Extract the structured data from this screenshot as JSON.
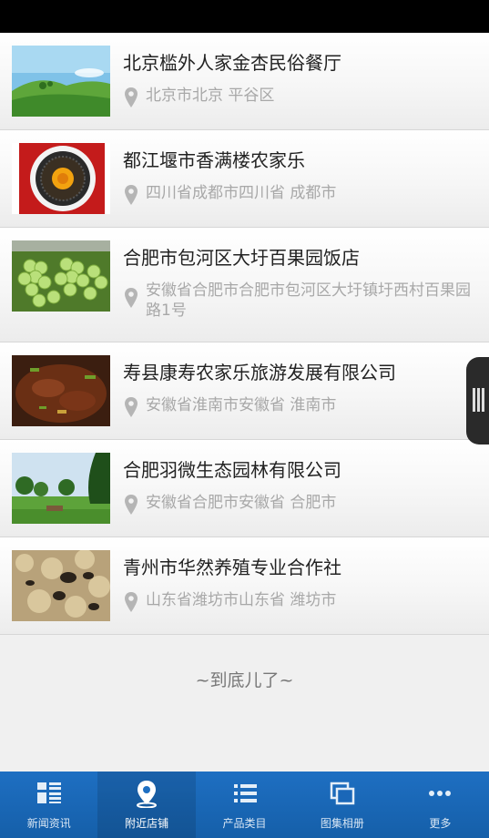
{
  "listings": [
    {
      "name": "北京槛外人家金杏民俗餐厅",
      "address": "北京市北京 平谷区",
      "thumb_icon": "green-hills-photo"
    },
    {
      "name": "都江堰市香满楼农家乐",
      "address": "四川省成都市四川省 成都市",
      "thumb_icon": "food-plate-photo"
    },
    {
      "name": "合肥市包河区大圩百果园饭店",
      "address": "安徽省合肥市合肥市包河区大圩镇圩西村百果园路1号",
      "thumb_icon": "grapes-photo"
    },
    {
      "name": "寿县康寿农家乐旅游发展有限公司",
      "address": "安徽省淮南市安徽省 淮南市",
      "thumb_icon": "braised-dish-photo"
    },
    {
      "name": "合肥羽微生态园林有限公司",
      "address": "安徽省合肥市安徽省 合肥市",
      "thumb_icon": "garden-park-photo"
    },
    {
      "name": "青州市华然养殖专业合作社",
      "address": "山东省潍坊市山东省 潍坊市",
      "thumb_icon": "mushrooms-photo"
    }
  ],
  "end_of_list": "~到底儿了~",
  "tabbar": {
    "tabs": [
      {
        "label": "新闻资讯",
        "icon": "news-grid-icon"
      },
      {
        "label": "附近店铺",
        "icon": "location-pin-icon",
        "active": true
      },
      {
        "label": "产品类目",
        "icon": "list-icon"
      },
      {
        "label": "图集相册",
        "icon": "gallery-icon"
      },
      {
        "label": "更多",
        "icon": "more-dots-icon"
      }
    ]
  },
  "colors": {
    "tabbar": "#1a67b8",
    "title": "#222222",
    "address": "#a8a8a8"
  }
}
